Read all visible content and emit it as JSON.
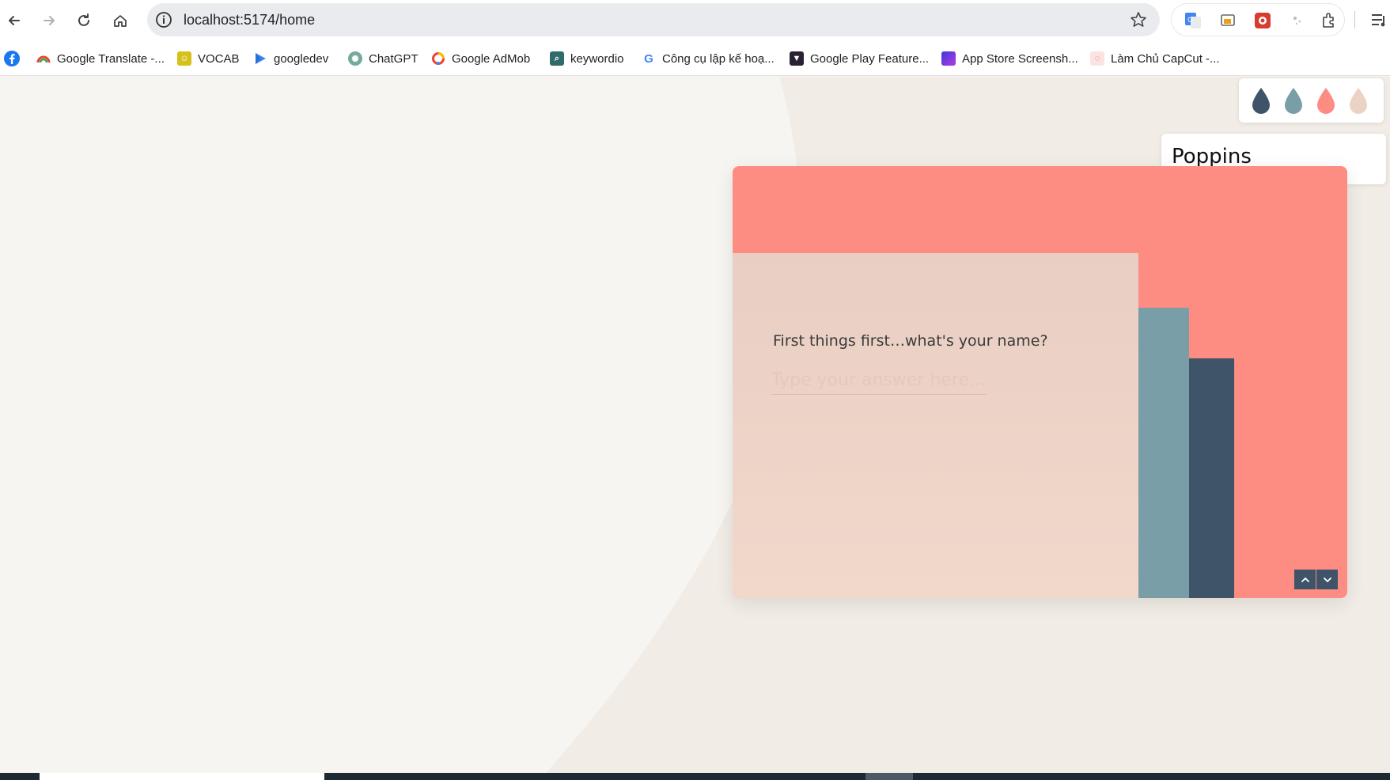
{
  "browser": {
    "url": "localhost:5174/home",
    "bookmarks": [
      {
        "label": "Google Translate -...",
        "icon": "google-translate-icon",
        "color": "#4285f4"
      },
      {
        "label": "VOCAB",
        "icon": "folder-icon",
        "color": "#c9b400"
      },
      {
        "label": "googledev",
        "icon": "play-icon",
        "color": "#4285f4"
      },
      {
        "label": "ChatGPT",
        "icon": "chatgpt-icon",
        "color": "#74aa9c"
      },
      {
        "label": "Google AdMob",
        "icon": "admob-icon",
        "color": "#ea4335"
      },
      {
        "label": "keywordio",
        "icon": "keywordio-icon",
        "color": "#2f6b6b"
      },
      {
        "label": "Công cụ lập kế hoạ...",
        "icon": "google-g-icon",
        "color": "#4285f4"
      },
      {
        "label": "Google Play Feature...",
        "icon": "play-feature-icon",
        "color": "#2b2135"
      },
      {
        "label": "App Store Screensh...",
        "icon": "app-store-icon",
        "color": "#7b3fe4"
      },
      {
        "label": "Làm Chủ CapCut -...",
        "icon": "capcut-icon",
        "color": "#f0a0a0"
      }
    ]
  },
  "page": {
    "palette": [
      "#3f5469",
      "#7a9ea7",
      "#fd8c82",
      "#ead3c4"
    ],
    "font_name": "Poppins",
    "question": "First things first…what's your name?",
    "answer_placeholder": "Type your answer here...",
    "colors": {
      "card_background": "#fd8c82",
      "form_background": "#efd6ca",
      "bar_light": "#7a9ea7",
      "bar_dark": "#3f5469"
    }
  }
}
